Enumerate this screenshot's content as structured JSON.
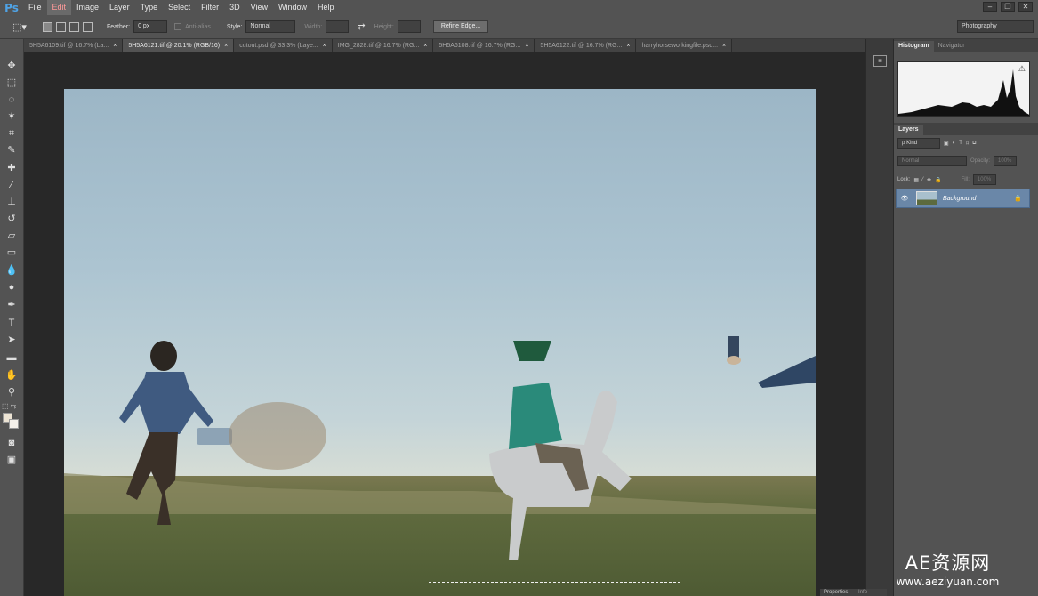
{
  "app": {
    "logo": "Ps"
  },
  "menu": [
    "File",
    "Edit",
    "Image",
    "Layer",
    "Type",
    "Select",
    "Filter",
    "3D",
    "View",
    "Window",
    "Help"
  ],
  "window_controls": [
    "–",
    "❐",
    "✕"
  ],
  "options": {
    "feather_label": "Feather:",
    "feather_value": "0 px",
    "antialias_label": "Anti-alias",
    "style_label": "Style:",
    "style_value": "Normal",
    "width_label": "Width:",
    "height_label": "Height:",
    "refine_button": "Refine Edge...",
    "workspace": "Photography"
  },
  "tabs": [
    {
      "label": "5H5A6109.tif @ 16.7% (La...",
      "active": false
    },
    {
      "label": "5H5A6121.tif @ 20.1% (RGB/16)",
      "active": true
    },
    {
      "label": "cutout.psd @ 33.3% (Laye...",
      "active": false
    },
    {
      "label": "IMG_2828.tif @ 16.7% (RG...",
      "active": false
    },
    {
      "label": "5H5A6108.tif @ 16.7% (RG...",
      "active": false
    },
    {
      "label": "5H5A6122.tif @ 16.7% (RG...",
      "active": false
    },
    {
      "label": "harryhorseworkingfile.psd...",
      "active": false
    }
  ],
  "tab_close": "×",
  "histogram_panel": {
    "tabs": [
      "Histogram",
      "Navigator"
    ],
    "warning": "⚠"
  },
  "layers_panel": {
    "tab": "Layers",
    "filter_kind": "ρ Kind",
    "blend_mode": "Normal",
    "opacity_label": "Opacity:",
    "opacity_value": "100%",
    "lock_label": "Lock:",
    "fill_label": "Fill:",
    "fill_value": "100%",
    "layers": [
      {
        "name": "Background",
        "visible": true,
        "locked": true
      }
    ]
  },
  "bottom_panel": {
    "tabs": [
      "Properties",
      "Info"
    ]
  },
  "watermark": {
    "title": "AE资源网",
    "url": "www.aeziyuan.com"
  }
}
